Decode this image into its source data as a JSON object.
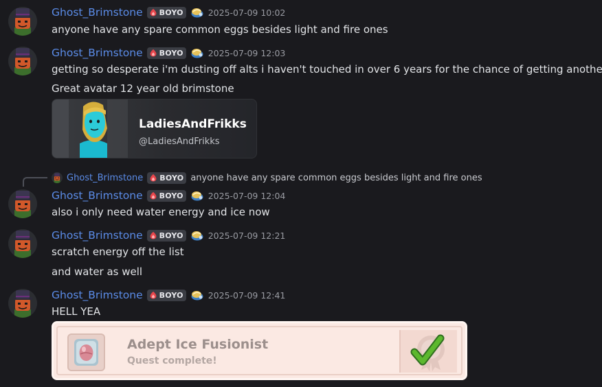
{
  "messages": [
    {
      "username": "Ghost_Brimstone",
      "tag": "BOYO",
      "timestamp": "2025-07-09 10:02",
      "lines": [
        "anyone have any spare common eggs besides light and fire ones"
      ]
    },
    {
      "username": "Ghost_Brimstone",
      "tag": "BOYO",
      "timestamp": "2025-07-09 12:03",
      "lines": [
        "getting so desperate i'm dusting off alts i haven't touched in over 6 years for the chance of getting another eg",
        "Great avatar 12 year old brimstone"
      ],
      "embed": {
        "name": "LadiesAndFrikks",
        "handle": "@LadiesAndFrikks"
      }
    },
    {
      "reply": {
        "username": "Ghost_Brimstone",
        "tag": "BOYO",
        "text": "anyone have any spare common eggs besides light and fire ones"
      },
      "username": "Ghost_Brimstone",
      "tag": "BOYO",
      "timestamp": "2025-07-09 12:04",
      "lines": [
        "also i only need water energy and ice now"
      ]
    },
    {
      "username": "Ghost_Brimstone",
      "tag": "BOYO",
      "timestamp": "2025-07-09 12:21",
      "lines": [
        "scratch energy off the list",
        "and water as well"
      ]
    },
    {
      "username": "Ghost_Brimstone",
      "tag": "BOYO",
      "timestamp": "2025-07-09 12:41",
      "lines": [
        "HELL YEA"
      ],
      "quest": {
        "title": "Adept Ice Fusionist",
        "subtitle": "Quest complete!"
      }
    }
  ],
  "icons": {
    "avatar": "brimstone-avatar-icon",
    "tag": "flame-badge-icon",
    "flair": "fossil-flair-icon",
    "quest_egg": "egg-icon",
    "quest_check": "checkmark-icon"
  },
  "colors": {
    "background": "#1a1a1e",
    "username": "#5b8ce8",
    "tag_bg": "#3b3d44",
    "quest_bg": "#fbe9e3",
    "check": "#5cb82e"
  }
}
